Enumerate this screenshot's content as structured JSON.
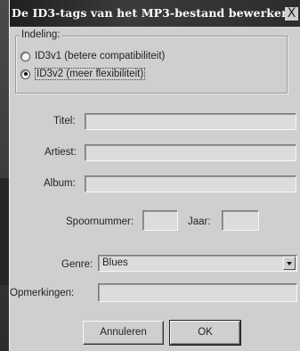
{
  "window": {
    "title": "De ID3-tags van het MP3-bestand bewerken",
    "close_label": "X"
  },
  "format_group": {
    "legend": "Indeling:",
    "options": [
      {
        "label": "ID3v1 (betere compatibiliteit)",
        "checked": false
      },
      {
        "label": "ID3v2 (meer flexibiliteit)",
        "checked": true
      }
    ]
  },
  "fields": {
    "title_label": "Titel:",
    "title_value": "",
    "artist_label": "Artiest:",
    "artist_value": "",
    "album_label": "Album:",
    "album_value": "",
    "track_label": "Spoornummer:",
    "track_value": "",
    "year_label": "Jaar:",
    "year_value": "",
    "genre_label": "Genre:",
    "genre_value": "Blues",
    "comments_label": "Opmerkingen:",
    "comments_value": ""
  },
  "buttons": {
    "cancel": "Annuleren",
    "ok": "OK"
  }
}
